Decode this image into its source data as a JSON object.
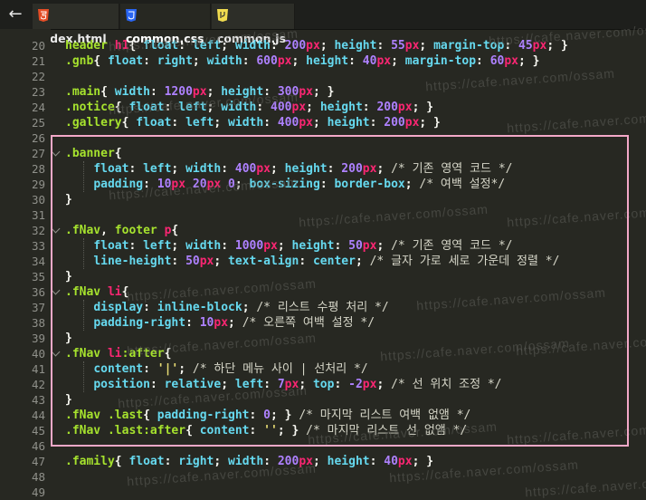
{
  "tabs": [
    {
      "label": "index.html",
      "icon": "html5-icon",
      "active": false
    },
    {
      "label": "common.css",
      "icon": "css-file-icon",
      "active": true
    },
    {
      "label": "common.js",
      "icon": "js-file-icon",
      "active": false
    }
  ],
  "watermark": "https://cafe.naver.com/ossam",
  "highlight_color": "#f3a8c8",
  "lines": [
    {
      "n": "20",
      "t": [
        [
          "header",
          "sel"
        ],
        [
          " ",
          ""
        ],
        [
          "h1",
          "tag"
        ],
        [
          "{ ",
          ""
        ],
        [
          "float",
          "prop"
        ],
        [
          ": ",
          ""
        ],
        [
          "left",
          "kw"
        ],
        [
          "; ",
          ""
        ],
        [
          "width",
          "prop"
        ],
        [
          ": ",
          ""
        ],
        [
          "200",
          "num"
        ],
        [
          "px",
          "unit"
        ],
        [
          "; ",
          ""
        ],
        [
          "height",
          "prop"
        ],
        [
          ": ",
          ""
        ],
        [
          "55",
          "num"
        ],
        [
          "px",
          "unit"
        ],
        [
          "; ",
          ""
        ],
        [
          "margin-top",
          "prop"
        ],
        [
          ": ",
          ""
        ],
        [
          "45",
          "num"
        ],
        [
          "px",
          "unit"
        ],
        [
          "; }",
          ""
        ]
      ]
    },
    {
      "n": "21",
      "t": [
        [
          ".gnb",
          "sel"
        ],
        [
          "{ ",
          ""
        ],
        [
          "float",
          "prop"
        ],
        [
          ": ",
          ""
        ],
        [
          "right",
          "kw"
        ],
        [
          "; ",
          ""
        ],
        [
          "width",
          "prop"
        ],
        [
          ": ",
          ""
        ],
        [
          "600",
          "num"
        ],
        [
          "px",
          "unit"
        ],
        [
          "; ",
          ""
        ],
        [
          "height",
          "prop"
        ],
        [
          ": ",
          ""
        ],
        [
          "40",
          "num"
        ],
        [
          "px",
          "unit"
        ],
        [
          "; ",
          ""
        ],
        [
          "margin-top",
          "prop"
        ],
        [
          ": ",
          ""
        ],
        [
          "60",
          "num"
        ],
        [
          "px",
          "unit"
        ],
        [
          "; }",
          ""
        ]
      ]
    },
    {
      "n": "22",
      "t": []
    },
    {
      "n": "23",
      "t": [
        [
          ".main",
          "sel"
        ],
        [
          "{ ",
          ""
        ],
        [
          "width",
          "prop"
        ],
        [
          ": ",
          ""
        ],
        [
          "1200",
          "num"
        ],
        [
          "px",
          "unit"
        ],
        [
          "; ",
          ""
        ],
        [
          "height",
          "prop"
        ],
        [
          ": ",
          ""
        ],
        [
          "300",
          "num"
        ],
        [
          "px",
          "unit"
        ],
        [
          "; }",
          ""
        ]
      ]
    },
    {
      "n": "24",
      "t": [
        [
          ".notice",
          "sel"
        ],
        [
          "{ ",
          ""
        ],
        [
          "float",
          "prop"
        ],
        [
          ": ",
          ""
        ],
        [
          "left",
          "kw"
        ],
        [
          "; ",
          ""
        ],
        [
          "width",
          "prop"
        ],
        [
          ": ",
          ""
        ],
        [
          "400",
          "num"
        ],
        [
          "px",
          "unit"
        ],
        [
          "; ",
          ""
        ],
        [
          "height",
          "prop"
        ],
        [
          ": ",
          ""
        ],
        [
          "200",
          "num"
        ],
        [
          "px",
          "unit"
        ],
        [
          "; }",
          ""
        ]
      ]
    },
    {
      "n": "25",
      "t": [
        [
          ".gallery",
          "sel"
        ],
        [
          "{ ",
          ""
        ],
        [
          "float",
          "prop"
        ],
        [
          ": ",
          ""
        ],
        [
          "left",
          "kw"
        ],
        [
          "; ",
          ""
        ],
        [
          "width",
          "prop"
        ],
        [
          ": ",
          ""
        ],
        [
          "400",
          "num"
        ],
        [
          "px",
          "unit"
        ],
        [
          "; ",
          ""
        ],
        [
          "height",
          "prop"
        ],
        [
          ": ",
          ""
        ],
        [
          "200",
          "num"
        ],
        [
          "px",
          "unit"
        ],
        [
          "; }",
          ""
        ]
      ]
    },
    {
      "n": "26",
      "t": []
    },
    {
      "n": "27",
      "fold": true,
      "t": [
        [
          ".banner",
          "sel"
        ],
        [
          "{",
          ""
        ]
      ]
    },
    {
      "n": "28",
      "t": [
        [
          "    ",
          ""
        ],
        [
          "float",
          "prop"
        ],
        [
          ": ",
          ""
        ],
        [
          "left",
          "kw"
        ],
        [
          "; ",
          ""
        ],
        [
          "width",
          "prop"
        ],
        [
          ": ",
          ""
        ],
        [
          "400",
          "num"
        ],
        [
          "px",
          "unit"
        ],
        [
          "; ",
          ""
        ],
        [
          "height",
          "prop"
        ],
        [
          ": ",
          ""
        ],
        [
          "200",
          "num"
        ],
        [
          "px",
          "unit"
        ],
        [
          "; ",
          ""
        ],
        [
          "/* 기존 영역 코드 */",
          "cm"
        ]
      ]
    },
    {
      "n": "29",
      "t": [
        [
          "    ",
          ""
        ],
        [
          "padding",
          "prop"
        ],
        [
          ": ",
          ""
        ],
        [
          "10",
          "num"
        ],
        [
          "px",
          "unit"
        ],
        [
          " ",
          ""
        ],
        [
          "20",
          "num"
        ],
        [
          "px",
          "unit"
        ],
        [
          " ",
          ""
        ],
        [
          "0",
          "num"
        ],
        [
          "; ",
          ""
        ],
        [
          "box-sizing",
          "prop"
        ],
        [
          ": ",
          ""
        ],
        [
          "border-box",
          "kw"
        ],
        [
          "; ",
          ""
        ],
        [
          "/* 여백 설정*/",
          "cm"
        ]
      ]
    },
    {
      "n": "30",
      "t": [
        [
          "}",
          ""
        ]
      ]
    },
    {
      "n": "31",
      "t": []
    },
    {
      "n": "32",
      "fold": true,
      "t": [
        [
          ".fNav",
          "sel"
        ],
        [
          ", ",
          ""
        ],
        [
          "footer",
          "sel"
        ],
        [
          " ",
          ""
        ],
        [
          "p",
          "tag"
        ],
        [
          "{",
          ""
        ]
      ]
    },
    {
      "n": "33",
      "t": [
        [
          "    ",
          ""
        ],
        [
          "float",
          "prop"
        ],
        [
          ": ",
          ""
        ],
        [
          "left",
          "kw"
        ],
        [
          "; ",
          ""
        ],
        [
          "width",
          "prop"
        ],
        [
          ": ",
          ""
        ],
        [
          "1000",
          "num"
        ],
        [
          "px",
          "unit"
        ],
        [
          "; ",
          ""
        ],
        [
          "height",
          "prop"
        ],
        [
          ": ",
          ""
        ],
        [
          "50",
          "num"
        ],
        [
          "px",
          "unit"
        ],
        [
          "; ",
          ""
        ],
        [
          "/* 기존 영역 코드 */",
          "cm"
        ]
      ]
    },
    {
      "n": "34",
      "t": [
        [
          "    ",
          ""
        ],
        [
          "line-height",
          "prop"
        ],
        [
          ": ",
          ""
        ],
        [
          "50",
          "num"
        ],
        [
          "px",
          "unit"
        ],
        [
          "; ",
          ""
        ],
        [
          "text-align",
          "prop"
        ],
        [
          ": ",
          ""
        ],
        [
          "center",
          "kw"
        ],
        [
          "; ",
          ""
        ],
        [
          "/* 글자 가로 세로 가운데 정렬 */",
          "cm"
        ]
      ]
    },
    {
      "n": "35",
      "t": [
        [
          "}",
          ""
        ]
      ]
    },
    {
      "n": "36",
      "fold": true,
      "t": [
        [
          ".fNav",
          "sel"
        ],
        [
          " ",
          ""
        ],
        [
          "li",
          "tag"
        ],
        [
          "{",
          ""
        ]
      ]
    },
    {
      "n": "37",
      "t": [
        [
          "    ",
          ""
        ],
        [
          "display",
          "prop"
        ],
        [
          ": ",
          ""
        ],
        [
          "inline-block",
          "kw"
        ],
        [
          "; ",
          ""
        ],
        [
          "/* 리스트 수평 처리 */",
          "cm"
        ]
      ]
    },
    {
      "n": "38",
      "t": [
        [
          "    ",
          ""
        ],
        [
          "padding-right",
          "prop"
        ],
        [
          ": ",
          ""
        ],
        [
          "10",
          "num"
        ],
        [
          "px",
          "unit"
        ],
        [
          "; ",
          ""
        ],
        [
          "/* 오른쪽 여백 설정 */",
          "cm"
        ]
      ]
    },
    {
      "n": "39",
      "t": [
        [
          "}",
          ""
        ]
      ]
    },
    {
      "n": "40",
      "fold": true,
      "t": [
        [
          ".fNav",
          "sel"
        ],
        [
          " ",
          ""
        ],
        [
          "li",
          "tag"
        ],
        [
          ":after",
          "sel"
        ],
        [
          "{",
          ""
        ]
      ]
    },
    {
      "n": "41",
      "t": [
        [
          "    ",
          ""
        ],
        [
          "content",
          "prop"
        ],
        [
          ": ",
          ""
        ],
        [
          "'|'",
          "str"
        ],
        [
          "; ",
          ""
        ],
        [
          "/* 하단 메뉴 사이 | 선처리 */",
          "cm"
        ]
      ]
    },
    {
      "n": "42",
      "t": [
        [
          "    ",
          ""
        ],
        [
          "position",
          "prop"
        ],
        [
          ": ",
          ""
        ],
        [
          "relative",
          "kw"
        ],
        [
          "; ",
          ""
        ],
        [
          "left",
          "prop"
        ],
        [
          ": ",
          ""
        ],
        [
          "7",
          "num"
        ],
        [
          "px",
          "unit"
        ],
        [
          "; ",
          ""
        ],
        [
          "top",
          "prop"
        ],
        [
          ": ",
          ""
        ],
        [
          "-2",
          "num"
        ],
        [
          "px",
          "unit"
        ],
        [
          "; ",
          ""
        ],
        [
          "/* 선 위치 조정 */",
          "cm"
        ]
      ]
    },
    {
      "n": "43",
      "t": [
        [
          "}",
          ""
        ]
      ]
    },
    {
      "n": "44",
      "t": [
        [
          ".fNav",
          "sel"
        ],
        [
          " ",
          ""
        ],
        [
          ".last",
          "sel"
        ],
        [
          "{ ",
          ""
        ],
        [
          "padding-right",
          "prop"
        ],
        [
          ": ",
          ""
        ],
        [
          "0",
          "num"
        ],
        [
          "; } ",
          ""
        ],
        [
          "/* 마지막 리스트 여백 없앰 */",
          "cm"
        ]
      ]
    },
    {
      "n": "45",
      "t": [
        [
          ".fNav",
          "sel"
        ],
        [
          " ",
          ""
        ],
        [
          ".last:after",
          "sel"
        ],
        [
          "{ ",
          ""
        ],
        [
          "content",
          "prop"
        ],
        [
          ": ",
          ""
        ],
        [
          "''",
          "str"
        ],
        [
          "; } ",
          ""
        ],
        [
          "/* 마지막 리스트 선 없앰 */",
          "cm"
        ]
      ]
    },
    {
      "n": "46",
      "t": []
    },
    {
      "n": "47",
      "t": [
        [
          ".family",
          "sel"
        ],
        [
          "{ ",
          ""
        ],
        [
          "float",
          "prop"
        ],
        [
          ": ",
          ""
        ],
        [
          "right",
          "kw"
        ],
        [
          "; ",
          ""
        ],
        [
          "width",
          "prop"
        ],
        [
          ": ",
          ""
        ],
        [
          "200",
          "num"
        ],
        [
          "px",
          "unit"
        ],
        [
          "; ",
          ""
        ],
        [
          "height",
          "prop"
        ],
        [
          ": ",
          ""
        ],
        [
          "40",
          "num"
        ],
        [
          "px",
          "unit"
        ],
        [
          "; }",
          ""
        ]
      ]
    },
    {
      "n": "48",
      "t": []
    },
    {
      "n": "49",
      "t": []
    }
  ]
}
